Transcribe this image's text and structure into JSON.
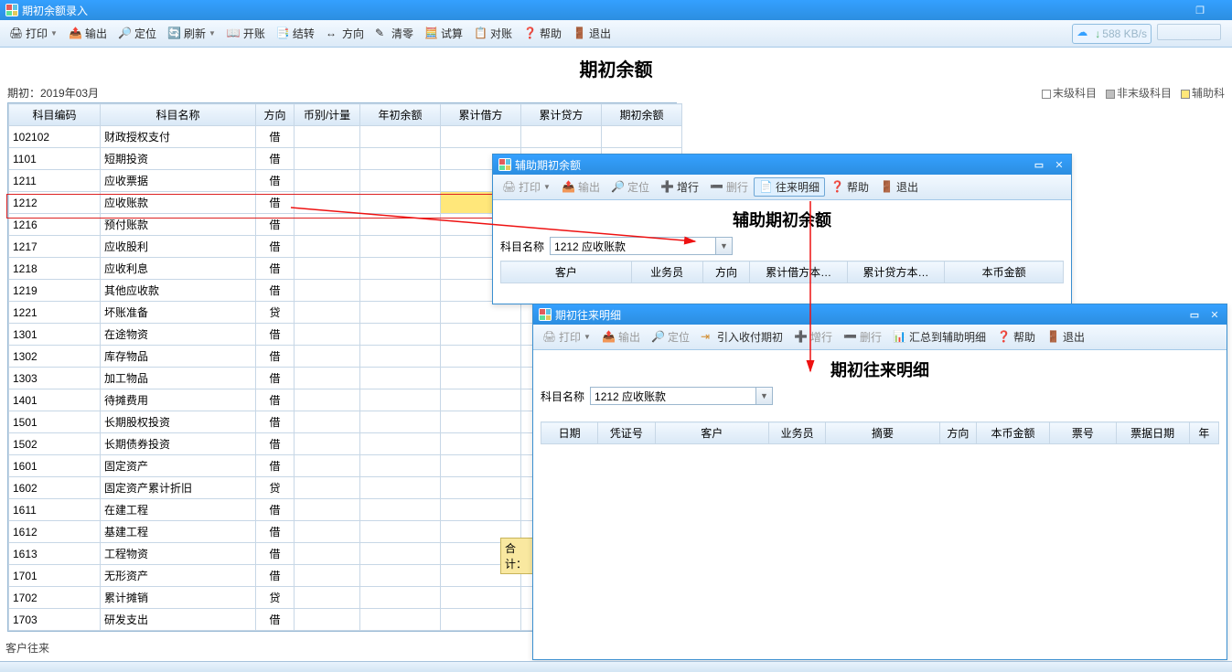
{
  "main": {
    "title": "期初余额录入",
    "toolbar": [
      "打印",
      "输出",
      "定位",
      "刷新",
      "开账",
      "结转",
      "方向",
      "清零",
      "试算",
      "对账",
      "帮助",
      "退出"
    ],
    "net_speed": "588 KB/s",
    "heading": "期初余额",
    "period_label": "期初：2019年03月",
    "legend": {
      "end": "末级科目",
      "nonend": "非末级科目",
      "aux": "辅助科"
    },
    "columns": [
      "科目编码",
      "科目名称",
      "方向",
      "币别/计量",
      "年初余额",
      "累计借方",
      "累计贷方",
      "期初余额"
    ],
    "rows": [
      {
        "code": "102102",
        "name": "财政授权支付",
        "dir": "借"
      },
      {
        "code": "1101",
        "name": "短期投资",
        "dir": "借"
      },
      {
        "code": "1211",
        "name": "应收票据",
        "dir": "借"
      },
      {
        "code": "1212",
        "name": "应收账款",
        "dir": "借"
      },
      {
        "code": "1216",
        "name": "预付账款",
        "dir": "借"
      },
      {
        "code": "1217",
        "name": "应收股利",
        "dir": "借"
      },
      {
        "code": "1218",
        "name": "应收利息",
        "dir": "借"
      },
      {
        "code": "1219",
        "name": "其他应收款",
        "dir": "借"
      },
      {
        "code": "1221",
        "name": "坏账准备",
        "dir": "贷"
      },
      {
        "code": "1301",
        "name": "在途物资",
        "dir": "借"
      },
      {
        "code": "1302",
        "name": "库存物品",
        "dir": "借"
      },
      {
        "code": "1303",
        "name": "加工物品",
        "dir": "借"
      },
      {
        "code": "1401",
        "name": "待摊费用",
        "dir": "借"
      },
      {
        "code": "1501",
        "name": "长期股权投资",
        "dir": "借"
      },
      {
        "code": "1502",
        "name": "长期债券投资",
        "dir": "借"
      },
      {
        "code": "1601",
        "name": "固定资产",
        "dir": "借"
      },
      {
        "code": "1602",
        "name": "固定资产累计折旧",
        "dir": "贷"
      },
      {
        "code": "1611",
        "name": "在建工程",
        "dir": "借"
      },
      {
        "code": "1612",
        "name": "基建工程",
        "dir": "借"
      },
      {
        "code": "1613",
        "name": "工程物资",
        "dir": "借"
      },
      {
        "code": "1701",
        "name": "无形资产",
        "dir": "借"
      },
      {
        "code": "1702",
        "name": "累计摊销",
        "dir": "贷"
      },
      {
        "code": "1703",
        "name": "研发支出",
        "dir": "借"
      }
    ],
    "total_label": "合计：",
    "status": "客户往来"
  },
  "dlg1": {
    "title": "辅助期初余额",
    "toolbar": [
      "打印",
      "输出",
      "定位",
      "增行",
      "删行",
      "往来明细",
      "帮助",
      "退出"
    ],
    "heading": "辅助期初余额",
    "field_label": "科目名称",
    "field_value": "1212 应收账款",
    "columns": [
      "客户",
      "业务员",
      "方向",
      "累计借方本…",
      "累计贷方本…",
      "本币金额"
    ]
  },
  "dlg2": {
    "title": "期初往来明细",
    "toolbar": [
      "打印",
      "输出",
      "定位",
      "引入收付期初",
      "增行",
      "删行",
      "汇总到辅助明细",
      "帮助",
      "退出"
    ],
    "heading": "期初往来明细",
    "field_label": "科目名称",
    "field_value": "1212 应收账款",
    "columns": [
      "日期",
      "凭证号",
      "客户",
      "业务员",
      "摘要",
      "方向",
      "本币金额",
      "票号",
      "票据日期",
      "年"
    ]
  }
}
